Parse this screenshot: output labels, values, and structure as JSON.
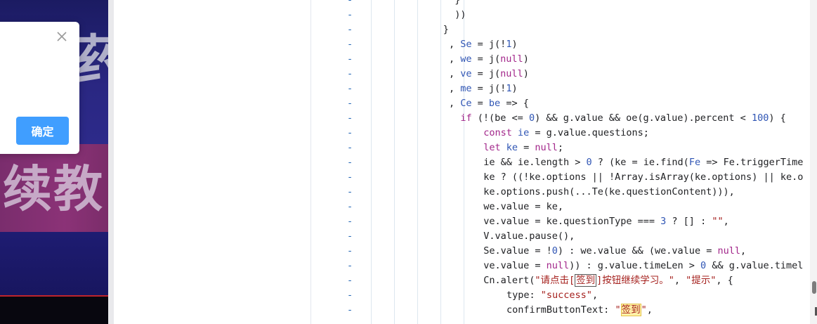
{
  "background_page": {
    "char_top": "药",
    "char_mid": "续教"
  },
  "dialog": {
    "close_icon": "close-icon",
    "ok_button_label": "确定",
    "accent_color": "#409eff"
  },
  "editor": {
    "lines": [
      {
        "marker": "-",
        "indent": 21,
        "tokens": [
          [
            "pn",
            "}"
          ]
        ]
      },
      {
        "marker": "-",
        "indent": 21,
        "tokens": [
          [
            "pn",
            "))"
          ]
        ]
      },
      {
        "marker": "-",
        "indent": 19,
        "tokens": [
          [
            "pn",
            "}"
          ]
        ]
      },
      {
        "marker": "-",
        "indent": 20,
        "tokens": [
          [
            "pn",
            ", "
          ],
          [
            "vr",
            "Se"
          ],
          [
            "pn",
            " = j(!"
          ],
          [
            "num",
            "1"
          ],
          [
            "pn",
            ")"
          ]
        ]
      },
      {
        "marker": "-",
        "indent": 20,
        "tokens": [
          [
            "pn",
            ", "
          ],
          [
            "vr",
            "we"
          ],
          [
            "pn",
            " = j("
          ],
          [
            "kw",
            "null"
          ],
          [
            "pn",
            ")"
          ]
        ]
      },
      {
        "marker": "-",
        "indent": 20,
        "tokens": [
          [
            "pn",
            ", "
          ],
          [
            "vr",
            "ve"
          ],
          [
            "pn",
            " = j("
          ],
          [
            "kw",
            "null"
          ],
          [
            "pn",
            ")"
          ]
        ]
      },
      {
        "marker": "-",
        "indent": 20,
        "tokens": [
          [
            "pn",
            ", "
          ],
          [
            "vr",
            "me"
          ],
          [
            "pn",
            " = j(!"
          ],
          [
            "num",
            "1"
          ],
          [
            "pn",
            ")"
          ]
        ]
      },
      {
        "marker": "-",
        "indent": 20,
        "tokens": [
          [
            "pn",
            ", "
          ],
          [
            "vr",
            "Ce"
          ],
          [
            "pn",
            " = "
          ],
          [
            "vr",
            "be"
          ],
          [
            "pn",
            " => {"
          ]
        ]
      },
      {
        "marker": "-",
        "indent": 22,
        "tokens": [
          [
            "kw",
            "if"
          ],
          [
            "pn",
            " (!(be <= "
          ],
          [
            "num",
            "0"
          ],
          [
            "pn",
            ") && g.value && oe(g.value).percent < "
          ],
          [
            "num",
            "100"
          ],
          [
            "pn",
            ") {"
          ]
        ]
      },
      {
        "marker": "-",
        "indent": 26,
        "tokens": [
          [
            "kw",
            "const"
          ],
          [
            "pn",
            " "
          ],
          [
            "vr",
            "ie"
          ],
          [
            "pn",
            " = g.value.questions;"
          ]
        ]
      },
      {
        "marker": "-",
        "indent": 26,
        "tokens": [
          [
            "kw",
            "let"
          ],
          [
            "pn",
            " "
          ],
          [
            "vr",
            "ke"
          ],
          [
            "pn",
            " = "
          ],
          [
            "kw",
            "null"
          ],
          [
            "pn",
            ";"
          ]
        ]
      },
      {
        "marker": "-",
        "indent": 26,
        "tokens": [
          [
            "pn",
            "ie && ie.length > "
          ],
          [
            "num",
            "0"
          ],
          [
            "pn",
            " ? (ke = ie.find("
          ],
          [
            "vr",
            "Fe"
          ],
          [
            "pn",
            " => Fe.triggerTime"
          ]
        ]
      },
      {
        "marker": "-",
        "indent": 26,
        "tokens": [
          [
            "pn",
            "ke ? ((!ke.options || !Array.isArray(ke.options) || ke.o"
          ]
        ]
      },
      {
        "marker": "-",
        "indent": 26,
        "tokens": [
          [
            "pn",
            "ke.options.push(...Te(ke.questionContent))),"
          ]
        ]
      },
      {
        "marker": "-",
        "indent": 26,
        "tokens": [
          [
            "pn",
            "we.value = ke,"
          ]
        ]
      },
      {
        "marker": "-",
        "indent": 26,
        "tokens": [
          [
            "pn",
            "ve.value = ke.questionType === "
          ],
          [
            "num",
            "3"
          ],
          [
            "pn",
            " ? [] : "
          ],
          [
            "str",
            "\"\""
          ],
          [
            "pn",
            ","
          ]
        ]
      },
      {
        "marker": "-",
        "indent": 26,
        "tokens": [
          [
            "pn",
            "V.value.pause(),"
          ]
        ]
      },
      {
        "marker": "-",
        "indent": 26,
        "tokens": [
          [
            "pn",
            "Se.value = !"
          ],
          [
            "num",
            "0"
          ],
          [
            "pn",
            ") : we.value && (we.value = "
          ],
          [
            "kw",
            "null"
          ],
          [
            "pn",
            ","
          ]
        ]
      },
      {
        "marker": "-",
        "indent": 26,
        "tokens": [
          [
            "pn",
            "ve.value = "
          ],
          [
            "kw",
            "null"
          ],
          [
            "pn",
            ")) : g.value.timeLen > "
          ],
          [
            "num",
            "0"
          ],
          [
            "pn",
            " && g.value.timel"
          ]
        ]
      },
      {
        "marker": "-",
        "indent": 26,
        "tokens": [
          [
            "pn",
            "Cn.alert("
          ],
          [
            "str",
            "\"请点击["
          ],
          [
            "str-box",
            "签到"
          ],
          [
            "str",
            "]按钮继续学习。\""
          ],
          [
            "pn",
            ", "
          ],
          [
            "str",
            "\"提示\""
          ],
          [
            "pn",
            ", {"
          ]
        ]
      },
      {
        "marker": "-",
        "indent": 30,
        "tokens": [
          [
            "pn",
            "type: "
          ],
          [
            "str",
            "\"success\""
          ],
          [
            "pn",
            ","
          ]
        ]
      },
      {
        "marker": "-",
        "indent": 30,
        "tokens": [
          [
            "pn",
            "confirmButtonText: "
          ],
          [
            "str",
            "\""
          ],
          [
            "str-yellow",
            "签到"
          ],
          [
            "str",
            "\""
          ],
          [
            "pn",
            ","
          ]
        ]
      }
    ]
  }
}
